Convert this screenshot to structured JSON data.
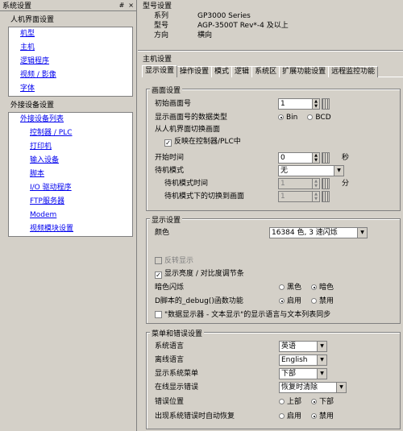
{
  "left_panel": {
    "title": "系统设置",
    "ctrls": [
      "#",
      "×"
    ],
    "sections": [
      {
        "title": "人机界面设置",
        "items": [
          {
            "label": "机型",
            "sub": false
          },
          {
            "label": "主机",
            "sub": false
          },
          {
            "label": "逻辑程序",
            "sub": false
          },
          {
            "label": "视频 / 影像",
            "sub": false
          },
          {
            "label": "字体",
            "sub": false
          }
        ]
      },
      {
        "title": "外接设备设置",
        "items": [
          {
            "label": "外接设备列表",
            "sub": false
          },
          {
            "label": "控制器 / PLC",
            "sub": true
          },
          {
            "label": "打印机",
            "sub": true
          },
          {
            "label": "输入设备",
            "sub": true
          },
          {
            "label": "脚本",
            "sub": true
          },
          {
            "label": "I/O 驱动程序",
            "sub": true
          },
          {
            "label": "FTP服务器",
            "sub": true
          },
          {
            "label": "Modem",
            "sub": true
          },
          {
            "label": "视频模块设置",
            "sub": true
          }
        ]
      }
    ]
  },
  "header": {
    "title": "型号设置",
    "rows": [
      {
        "k": "系列",
        "v": "GP3000 Series"
      },
      {
        "k": "型号",
        "v": "AGP-3500T  Rev*-4 及以上"
      },
      {
        "k": "方向",
        "v": "横向"
      }
    ]
  },
  "main": {
    "title": "主机设置",
    "tabs": [
      "显示设置",
      "操作设置",
      "模式",
      "逻辑",
      "系统区",
      "扩展功能设置",
      "远程监控功能"
    ],
    "screen": {
      "title": "画面设置",
      "init_label": "初始画面号",
      "init_value": "1",
      "type_label": "显示画面号的数据类型",
      "type_opts": [
        "Bin",
        "BCD"
      ],
      "switch_label": "从人机界面切换画面",
      "reflect_label": "反映在控制器/PLC中",
      "start_label": "开始时间",
      "start_value": "0",
      "start_unit": "秒",
      "standby_label": "待机模式",
      "standby_value": "无",
      "standby_time_label": "待机模式时间",
      "standby_time_value": "1",
      "standby_time_unit": "分",
      "standby_screen_label": "待机模式下的切换到画面",
      "standby_screen_value": "1"
    },
    "display": {
      "title": "显示设置",
      "color_label": "颜色",
      "color_value": "16384 色, 3 速闪烁",
      "reverse_label": "反转显示",
      "brightness_label": "显示亮度 / 对比度调节条",
      "blink_label": "暗色闪烁",
      "blink_opts": [
        "黑色",
        "暗色"
      ],
      "debug_label": "D脚本的_debug()函数功能",
      "debug_opts": [
        "启用",
        "禁用"
      ],
      "sync_label": "\"数据显示器 - 文本显示\"的显示语言与文本列表同步"
    },
    "menu": {
      "title": "菜单和错误设置",
      "rows": [
        {
          "label": "系统语言",
          "value": "英语",
          "w": 60
        },
        {
          "label": "离线语言",
          "value": "English",
          "w": 60
        },
        {
          "label": "显示系统菜单",
          "value": "下部",
          "w": 60
        },
        {
          "label": "在线显示错误",
          "value": "恢复时清除",
          "w": 84
        }
      ],
      "errpos_label": "错误位置",
      "errpos_opts": [
        "上部",
        "下部"
      ],
      "auto_label": "出现系统错误时自动恢复",
      "auto_opts": [
        "启用",
        "禁用"
      ]
    }
  }
}
